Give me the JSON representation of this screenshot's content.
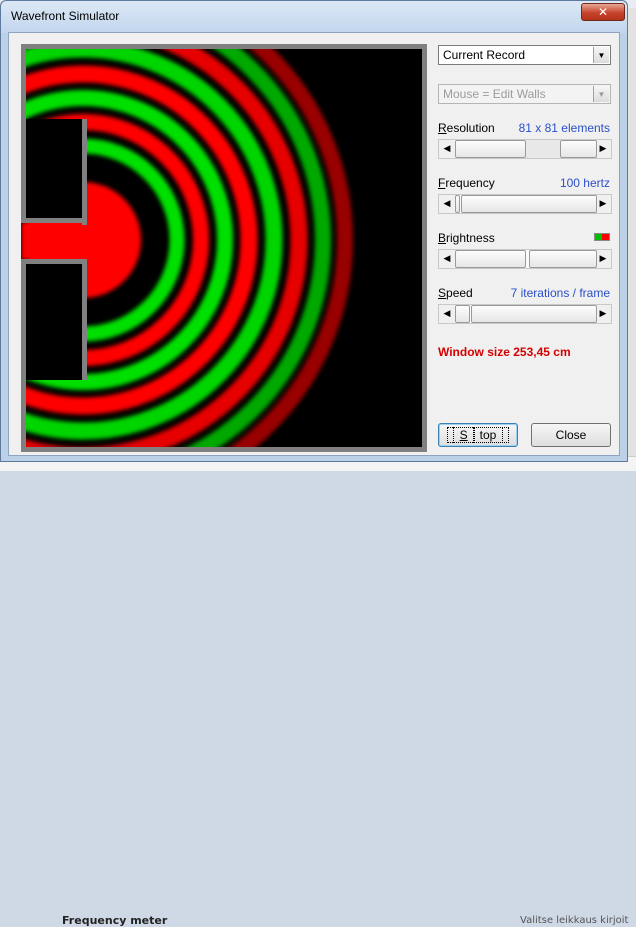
{
  "window": {
    "title": "Wavefront Simulator",
    "close_glyph": "✕"
  },
  "controls": {
    "record_select": {
      "selected": "Current Record"
    },
    "mouse_select": {
      "selected": "Mouse = Edit Walls",
      "disabled": true
    },
    "resolution": {
      "label_u": "R",
      "label_rest": "esolution",
      "value": "81 x 81 elements"
    },
    "frequency": {
      "label_u": "F",
      "label_rest": "requency",
      "value": "100 hertz"
    },
    "brightness": {
      "label_u": "B",
      "label_rest": "rightness",
      "colors": [
        "#00c000",
        "#ff0000"
      ]
    },
    "speed": {
      "label_u": "S",
      "label_rest": "peed",
      "value": "7 iterations / frame"
    },
    "status_text": "Window size 253,45 cm",
    "stop_button": {
      "label_u": "S",
      "label_rest": "top"
    },
    "close_button": {
      "label": "Close"
    }
  },
  "background": {
    "bottom_left_text": "Frequency meter",
    "bottom_right_text": "Valitse leikkaus kirjoit"
  },
  "colors": {
    "wave_positive": "#ff0000",
    "wave_negative": "#00e000",
    "wall": "#808080",
    "field": "#000000",
    "status": "#d40000",
    "value_text": "#2b4fc9"
  },
  "icons": {
    "scroll_left": "◀",
    "scroll_right": "▶",
    "dropdown": "▼"
  }
}
